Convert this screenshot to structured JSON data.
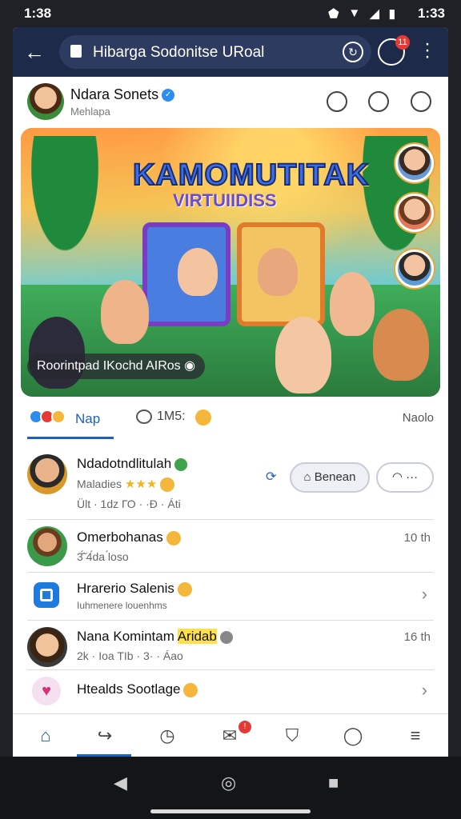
{
  "status": {
    "time_left": "1:38",
    "time_right": "1:33"
  },
  "browser": {
    "url_text": "Hibarga Sodonitse URoal",
    "tab_badge": "11"
  },
  "profile": {
    "name": "Ndara Sonets",
    "subtitle": "Mehlapa"
  },
  "banner": {
    "title_line1": "KAMOMUTITAK",
    "title_line2": "VIRTUIIDISS",
    "caption": "Roorintpad IKochd AIRos"
  },
  "tabs": {
    "first": "Nap",
    "second": "1M5:",
    "third": "Naolo"
  },
  "feed": {
    "items": [
      {
        "title": "Ndadotndlitulah",
        "line2": "Maladies",
        "line3": "Ült · 1dz   ГО · ·Ð · Áti",
        "action_primary": "Benean"
      },
      {
        "title": "Omerbohanas",
        "line2": "3́̃̄ 4́da ́loso",
        "time": "10 th"
      },
      {
        "title": "Hrarerio Salenis",
        "line2": "Iuhmenere louenhms"
      },
      {
        "title": "Nana Komintam",
        "title_highlight": "Aridab",
        "line2": "2k · Ioa  TIb · 3· · Áao",
        "time": "16 th"
      },
      {
        "title": "Htealds Sootlage"
      }
    ]
  },
  "colors": {
    "accent": "#1f5fbf",
    "urlbar": "#1e2a4a",
    "badge": "#e53935"
  }
}
